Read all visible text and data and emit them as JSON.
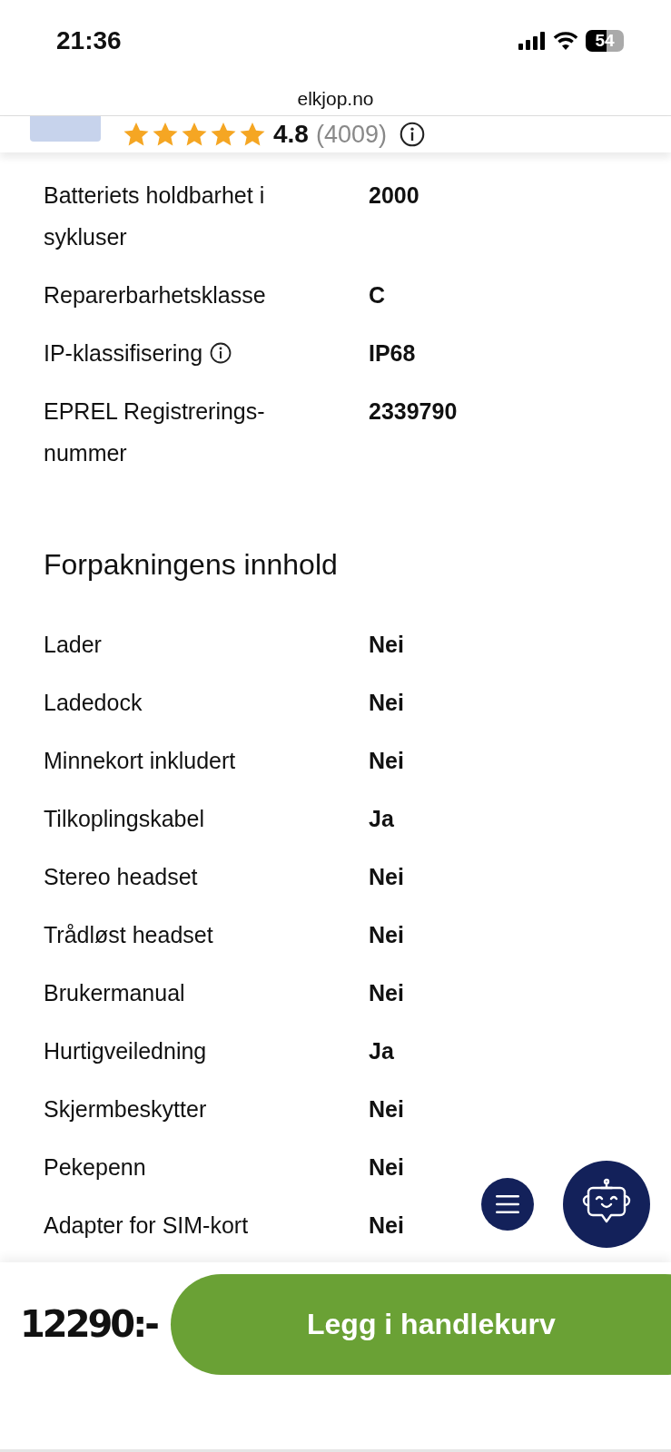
{
  "status_bar": {
    "time": "21:36",
    "battery": "54"
  },
  "address_bar": {
    "url": "elkjop.no"
  },
  "product": {
    "stars": 5,
    "rating": "4.8",
    "review_count": "(4009)"
  },
  "specs": [
    {
      "label": "Batteriets holdbarhet i sykluser",
      "value": "2000",
      "has_info": false
    },
    {
      "label": "Reparerbarhetsklasse",
      "value": "C",
      "has_info": false
    },
    {
      "label": "IP-klassifisering",
      "value": "IP68",
      "has_info": true
    },
    {
      "label": "EPREL Registrerings-nummer",
      "value": "2339790",
      "has_info": false
    }
  ],
  "package_section": {
    "title": "Forpakningens innhold",
    "rows": [
      {
        "label": "Lader",
        "value": "Nei"
      },
      {
        "label": "Ladedock",
        "value": "Nei"
      },
      {
        "label": "Minnekort inkludert",
        "value": "Nei"
      },
      {
        "label": "Tilkoplingskabel",
        "value": "Ja"
      },
      {
        "label": "Stereo headset",
        "value": "Nei"
      },
      {
        "label": "Trådløst headset",
        "value": "Nei"
      },
      {
        "label": "Brukermanual",
        "value": "Nei"
      },
      {
        "label": "Hurtigveiledning",
        "value": "Ja"
      },
      {
        "label": "Skjermbeskytter",
        "value": "Nei"
      },
      {
        "label": "Pekepenn",
        "value": "Nei"
      },
      {
        "label": "Adapter for SIM-kort",
        "value": "Nei"
      }
    ]
  },
  "buy_bar": {
    "price": "12290:-",
    "button": "Legg i handlekurv"
  }
}
